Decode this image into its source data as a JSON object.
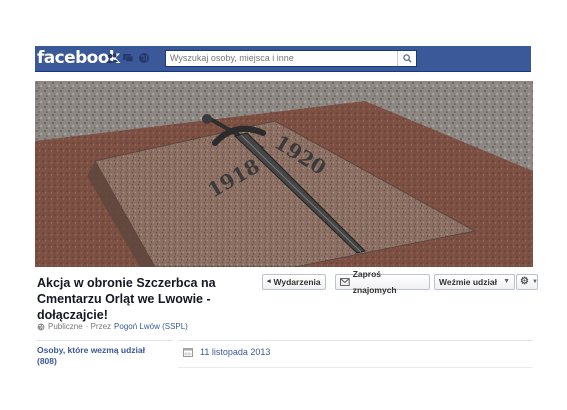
{
  "topbar": {
    "logo": "facebook",
    "search_placeholder": "Wyszukaj osoby, miejsca i inne",
    "icons": [
      "friends-icon",
      "messages-icon",
      "globe-icon"
    ]
  },
  "cover": {
    "dates": [
      "1918",
      "1920"
    ]
  },
  "event": {
    "title_lines": [
      "Akcja w obronie Szczerbca na",
      "Cmentarzu Orląt we Lwowie -",
      "dołączajcie!"
    ],
    "privacy": "Publiczne",
    "by_prefix": "· Przez",
    "host": "Pogoń Lwów (SSPL)"
  },
  "buttons": {
    "events": "Wydarzenia",
    "invite": "Zaproś znajomych",
    "join": "Weźmie udział"
  },
  "sidebar": {
    "attendees_line1": "Osoby, które wezmą udział",
    "attendees_line2": "(808)"
  },
  "details": {
    "date": "11 listopada 2013"
  },
  "colors": {
    "brand": "#3b5998",
    "granite": "#8a7166"
  }
}
